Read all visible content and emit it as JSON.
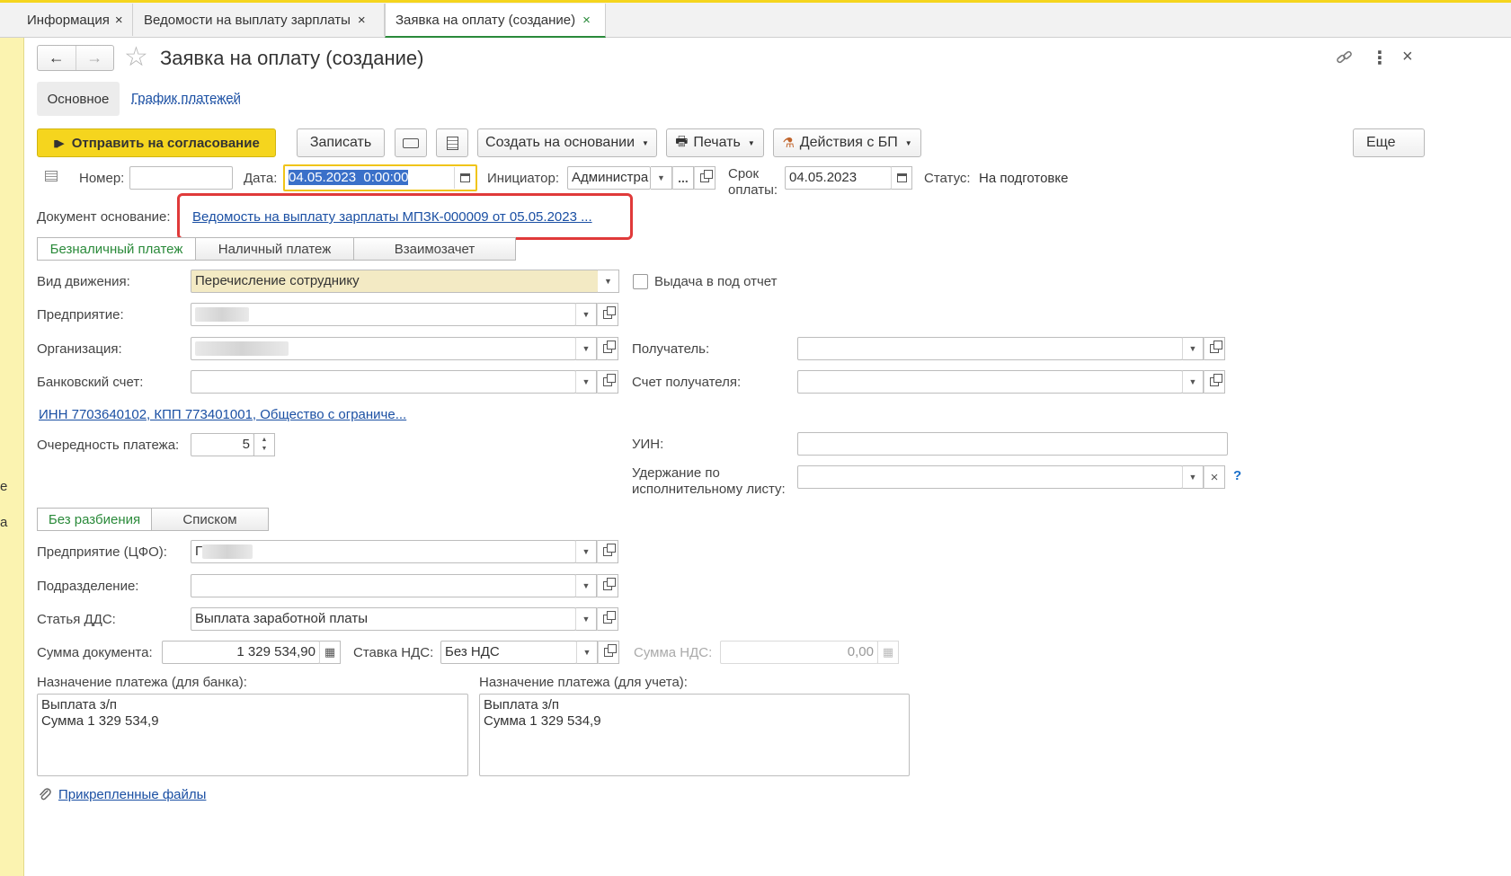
{
  "tabs": [
    {
      "label": "Информация",
      "close": "×"
    },
    {
      "label": "Ведомости на выплату зарплаты",
      "close": "×"
    },
    {
      "label": "Заявка на оплату (создание)",
      "close": "×"
    }
  ],
  "window": {
    "title": "Заявка на оплату (создание)",
    "nav_back": "←",
    "nav_forward": "→",
    "star": "☆",
    "link_icon": "link-icon",
    "more_icon": "⋮",
    "close_icon": "×"
  },
  "form_tabs": {
    "main": "Основное",
    "schedule": "График платежей"
  },
  "toolbar": {
    "send_label": "Отправить на согласование",
    "save_label": "Записать",
    "create_based_label": "Создать на основании",
    "print_label": "Печать",
    "bp_actions_label": "Действия с БП",
    "more_label": "Еще"
  },
  "header_fields": {
    "number_label": "Номер:",
    "number_value": "",
    "date_label": "Дата:",
    "date_value": "04.05.2023  0:00:00",
    "initiator_label": "Инициатор:",
    "initiator_value": "Администра",
    "initiator_select": "...",
    "due_label_1": "Срок",
    "due_label_2": "оплаты:",
    "due_value": "04.05.2023",
    "status_label": "Статус:",
    "status_value": "На подготовке"
  },
  "basis": {
    "label": "Документ основание:",
    "link": "Ведомость на выплату зарплаты МПЗК-000009 от 05.05.2023 ..."
  },
  "payment_tabs": [
    "Безналичный платеж",
    "Наличный платеж",
    "Взаимозачет"
  ],
  "left_fields": {
    "movement_label": "Вид движения:",
    "movement_value": "Перечисление сотруднику",
    "enterprise_label": "Предприятие:",
    "organization_label": "Организация:",
    "bank_account_label": "Банковский счет:",
    "bank_account_value": "",
    "inn_link": "ИНН 7703640102, КПП 773401001, Общество с ограниче...",
    "priority_label": "Очередность платежа:",
    "priority_value": "5"
  },
  "right_fields": {
    "advance_label": "Выдача в под отчет",
    "advance_checked": false,
    "recipient_label": "Получатель:",
    "recipient_value": "",
    "recipient_account_label": "Счет получателя:",
    "recipient_account_value": "",
    "uin_label": "УИН:",
    "uin_value": "",
    "withholding_label_1": "Удержание по",
    "withholding_label_2": "исполнительному листу:",
    "withholding_value": "",
    "help": "?"
  },
  "split_tabs": [
    "Без разбиения",
    "Списком"
  ],
  "split_fields": {
    "cfo_label": "Предприятие (ЦФО):",
    "cfo_value_prefix": "Г",
    "department_label": "Подразделение:",
    "department_value": "",
    "dds_label": "Статья ДДС:",
    "dds_value": "Выплата заработной платы"
  },
  "amounts": {
    "doc_sum_label": "Сумма документа:",
    "doc_sum_value": "1 329 534,90",
    "vat_rate_label": "Ставка НДС:",
    "vat_rate_value": "Без НДС",
    "vat_sum_label": "Сумма НДС:",
    "vat_sum_value": "0,00"
  },
  "purpose": {
    "bank_label": "Назначение платежа (для банка):",
    "bank_value": "Выплата з/п\nСумма 1 329 534,9",
    "account_label": "Назначение платежа (для учета):",
    "account_value": "Выплата з/п\nСумма 1 329 534,9"
  },
  "attachments": {
    "link": "Прикрепленные файлы"
  },
  "side_letters": [
    "е",
    "а"
  ],
  "colors": {
    "accent_yellow": "#f5d51e",
    "highlight_red": "#e03a3a",
    "link_blue": "#1a4fa3",
    "active_tab_green": "#2a8a3a",
    "left_strip": "#fbf3b0"
  }
}
